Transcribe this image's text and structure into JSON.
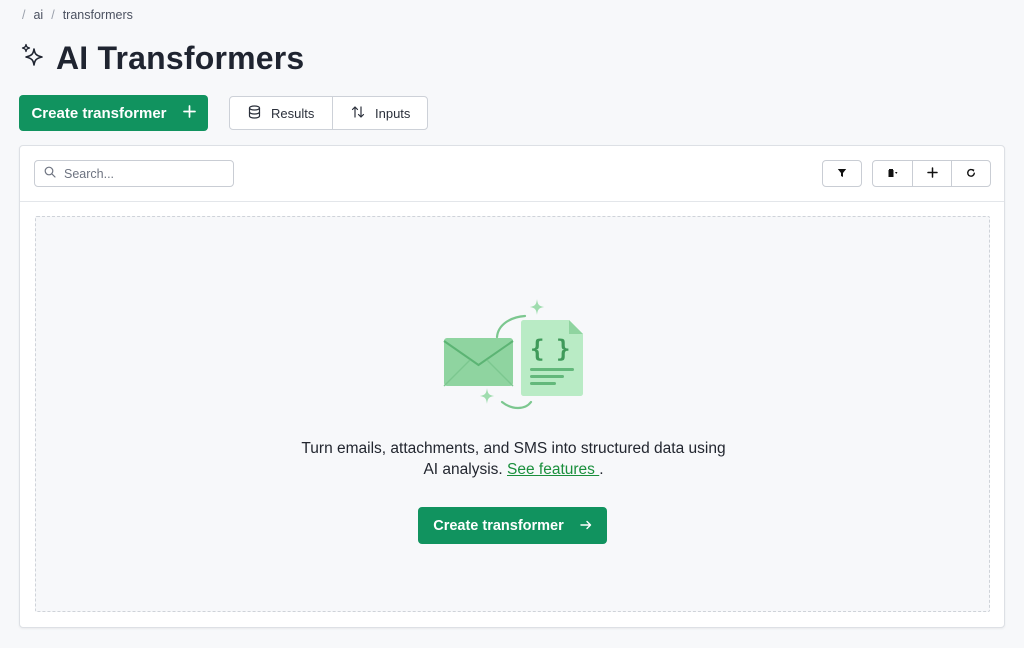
{
  "breadcrumb": {
    "items": [
      "ai",
      "transformers"
    ]
  },
  "page": {
    "title": "AI Transformers"
  },
  "actions": {
    "create_label": "Create transformer",
    "results_label": "Results",
    "inputs_label": "Inputs"
  },
  "search": {
    "placeholder": "Search...",
    "value": ""
  },
  "empty_state": {
    "line1": "Turn emails, attachments, and SMS into structured data using",
    "line2_prefix": "AI analysis. ",
    "link_label": "See features ",
    "line2_suffix": ".",
    "cta_label": "Create transformer"
  },
  "colors": {
    "primary": "#11935f",
    "link": "#1a8f3c",
    "illustration_green": "#7cc78f"
  },
  "icons": [
    "sparkles-icon",
    "plus-icon",
    "database-icon",
    "arrows-up-down-icon",
    "search-icon",
    "filter-icon",
    "columns-icon",
    "refresh-icon",
    "arrow-right-icon",
    "envelope-icon",
    "json-document-icon"
  ]
}
